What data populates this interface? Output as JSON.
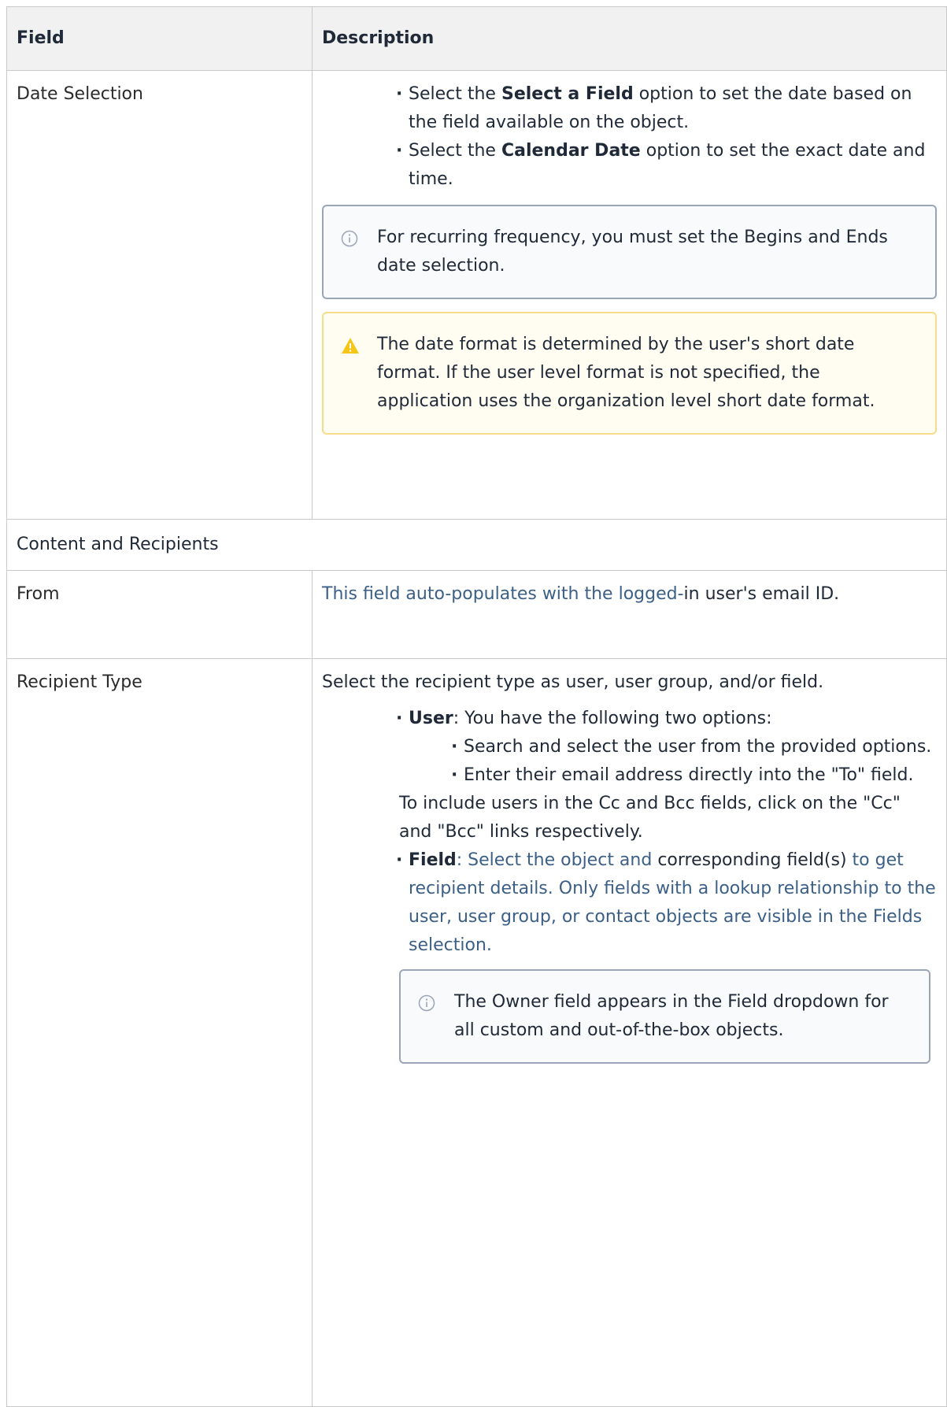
{
  "table": {
    "header": {
      "field": "Field",
      "description": "Description"
    },
    "date_selection": {
      "field": "Date Selection",
      "bullet1": {
        "pre": "Select the ",
        "bold": "Select a Field",
        "post": " option to set the date based on the field available on the object."
      },
      "bullet2": {
        "pre": "Select the ",
        "bold": "Calendar Date",
        "post": " option to set the exact date and time."
      },
      "info_note": "For recurring frequency, you must set the Begins and Ends date selection.",
      "warning_note": "The date format is determined by the user's short date format. If the user level format is not specified, the application uses the organization level short date format."
    },
    "section_label": "Content and Recipients",
    "from": {
      "field": "From",
      "desc_link": "This field auto-populates with the logged-",
      "desc_rest": "in user's email ID."
    },
    "recipient_type": {
      "field": "Recipient Type",
      "intro": "Select the recipient type as user, user group, and/or field.",
      "user_label": "User",
      "user_text": ": You have the following two options:",
      "user_opt1": "Search and select the user from the provided options.",
      "user_opt2": "Enter their email address directly into the \"To\" field.",
      "cc_note": "To include users in the Cc and Bcc fields, click on the \"Cc\" and \"Bcc\" links respectively.",
      "field_label": "Field",
      "field_text_link1": ": Select the object and",
      "field_text_plain": " corresponding field(s)",
      "field_text_link2": " to get recipient details. Only fields with a lookup relationship to the user, user group, or contact objects are visible in the Fields selection.",
      "info_note": "The Owner field appears in the Field dropdown for all custom and out-of-the-box objects."
    }
  },
  "icons": {
    "info": "info-circle-icon",
    "warning": "warning-triangle-icon"
  },
  "colors": {
    "info_border": "#9aa6b8",
    "warning_border": "#f6dc8a",
    "warning_icon": "#f5c518",
    "link": "#3b5f86",
    "header_bg": "#f1f1f1"
  }
}
